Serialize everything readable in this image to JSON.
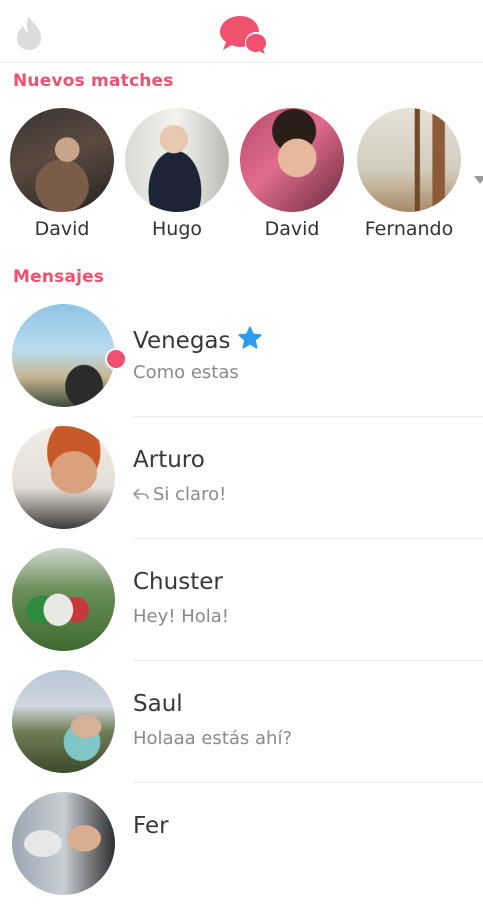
{
  "sections": {
    "matches_label": "Nuevos matches",
    "messages_label": "Mensajes"
  },
  "matches": [
    {
      "name": "David"
    },
    {
      "name": "Hugo"
    },
    {
      "name": "David"
    },
    {
      "name": "Fernando"
    }
  ],
  "messages": [
    {
      "name": "Venegas",
      "preview": "Como estas",
      "unread": true,
      "super_like": true
    },
    {
      "name": "Arturo",
      "preview": "Si claro!",
      "replied": true
    },
    {
      "name": "Chuster",
      "preview": "Hey! Hola!"
    },
    {
      "name": "Saul",
      "preview": "Holaaa estás ahí?"
    },
    {
      "name": "Fer",
      "preview": ""
    }
  ],
  "colors": {
    "accent": "#f0516e",
    "star": "#2b9cf2",
    "inactive_icon": "#dcdcdc"
  },
  "icons": {
    "left": "flame-icon",
    "center": "chat-bubbles-icon",
    "star": "star-icon",
    "reply": "reply-arrow-icon"
  }
}
